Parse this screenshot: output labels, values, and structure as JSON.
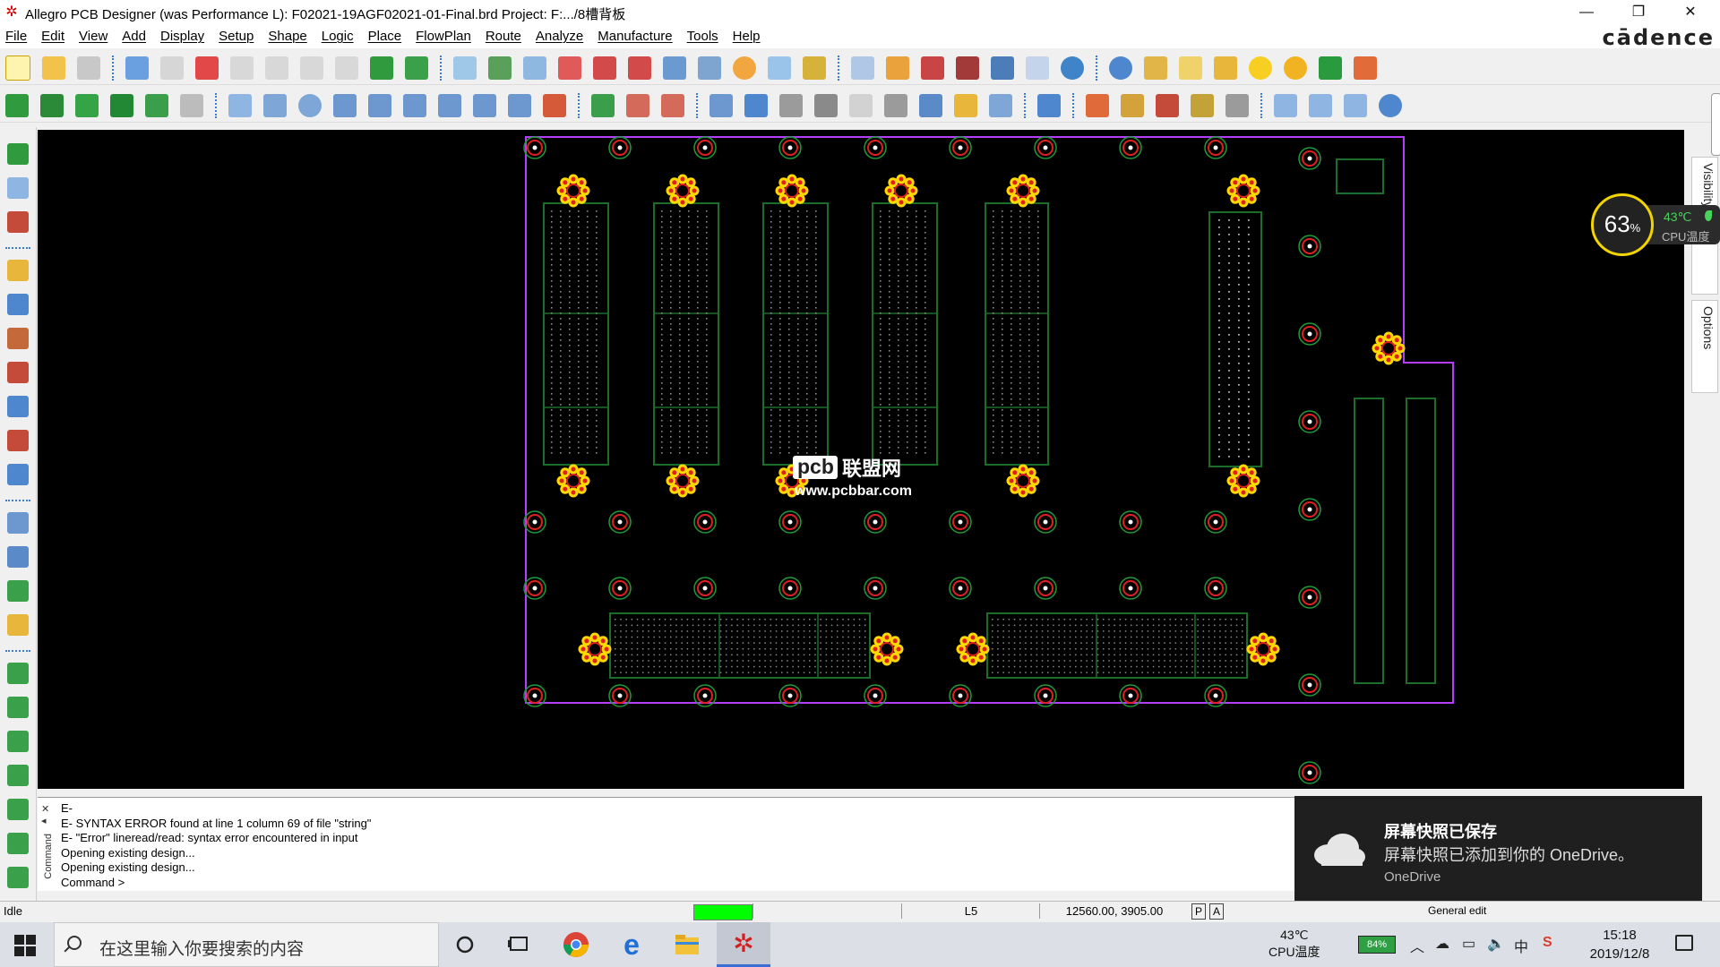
{
  "window": {
    "title": "Allegro PCB Designer (was Performance L): F02021-19AGF02021-01-Final.brd  Project: F:.../8槽背板",
    "app_icon": "allegro-icon",
    "controls": {
      "minimize": "—",
      "restore": "❐",
      "close": "✕"
    }
  },
  "menu": {
    "items": [
      "File",
      "Edit",
      "View",
      "Add",
      "Display",
      "Setup",
      "Shape",
      "Logic",
      "Place",
      "FlowPlan",
      "Route",
      "Analyze",
      "Manufacture",
      "Tools",
      "Help"
    ],
    "brand": "cādence"
  },
  "canvas": {
    "watermark_logo": "pcb",
    "watermark_cn": "联盟网",
    "watermark_url": "www.pcbbar.com",
    "colors": {
      "board_outline": "#b43dff",
      "pad": "#e02020",
      "via_ring": "#1f9a3a",
      "component": "#1b6e2a",
      "footprint_glow": "#ffd800"
    }
  },
  "right_panel": {
    "tabs": [
      "Visibility",
      "Options"
    ]
  },
  "cpu_widget": {
    "percent": "63",
    "percent_sign": "%",
    "temp": "43℃",
    "label": "CPU温度"
  },
  "command": {
    "vertical_label": "Command",
    "lines": [
      "E-",
      "E- SYNTAX ERROR found at line 1 column 69 of file \"string\"",
      "E- \"Error\" lineread/read: syntax error encountered in input",
      "Opening existing design...",
      "Opening existing design...",
      "Command >"
    ]
  },
  "toast": {
    "title": "屏幕快照已保存",
    "body": "屏幕快照已添加到你的 OneDrive。",
    "source": "OneDrive"
  },
  "status": {
    "state": "Idle",
    "layer": "L5",
    "coords": "12560.00, 3905.00",
    "p_label": "P",
    "a_label": "A",
    "mode": "General edit"
  },
  "taskbar": {
    "search_placeholder": "在这里输入你要搜索的内容",
    "tray_temp": "43℃",
    "tray_temp_label": "CPU温度",
    "battery": "84%",
    "ime": "中",
    "time": "15:18",
    "date": "2019/12/8"
  }
}
